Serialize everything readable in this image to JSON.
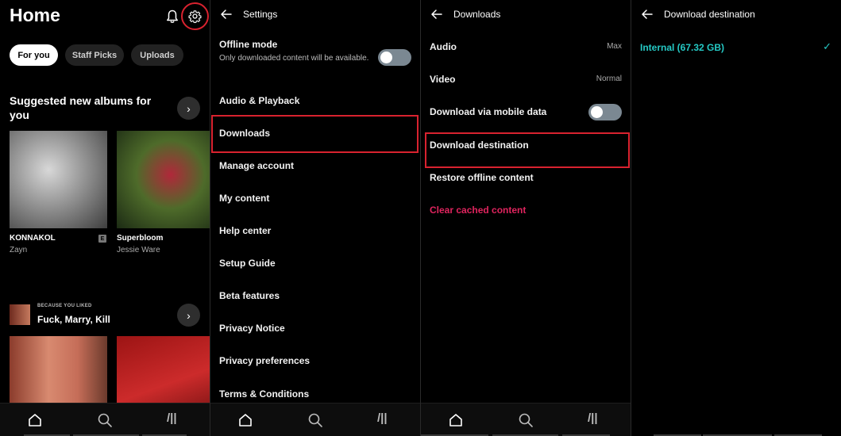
{
  "home": {
    "title": "Home",
    "chips": [
      "For you",
      "Staff Picks",
      "Uploads"
    ],
    "section_title": "Suggested new albums for you",
    "albums": [
      {
        "title": "KONNAKOL",
        "artist": "Zayn",
        "explicit": "E"
      },
      {
        "title": "Superbloom",
        "artist": "Jessie Ware"
      }
    ],
    "because_label": "BECAUSE YOU LIKED",
    "because_title": "Fuck, Marry, Kill",
    "icons": {
      "bell": "bell-icon",
      "gear": "gear-icon"
    }
  },
  "bottom_nav": {
    "library_glyph": "/||"
  },
  "settings": {
    "title": "Settings",
    "offline_mode": {
      "label": "Offline mode",
      "description": "Only downloaded content will be available.",
      "enabled": false
    },
    "items": [
      "Audio & Playback",
      "Downloads",
      "Manage account",
      "My content",
      "Help center",
      "Setup Guide",
      "Beta features",
      "Privacy Notice",
      "Privacy preferences",
      "Terms & Conditions"
    ]
  },
  "downloads": {
    "title": "Downloads",
    "audio": {
      "label": "Audio",
      "value": "Max"
    },
    "video": {
      "label": "Video",
      "value": "Normal"
    },
    "mobile_data": {
      "label": "Download via mobile data",
      "enabled": false
    },
    "destination_label": "Download destination",
    "restore_label": "Restore offline content",
    "clear_label": "Clear cached content"
  },
  "destination": {
    "title": "Download destination",
    "option": "Internal (67.32 GB)",
    "check": "✓"
  },
  "colors": {
    "accent": "#25c9c5",
    "danger": "#e0245e",
    "highlight": "#d9222f"
  }
}
